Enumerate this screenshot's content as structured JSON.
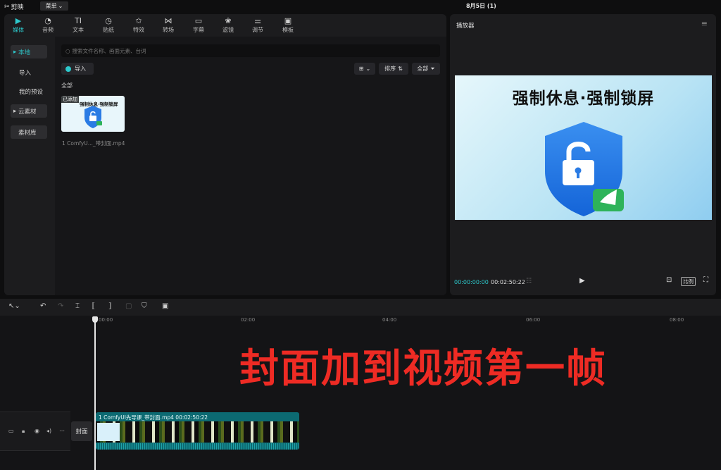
{
  "app": {
    "name": "剪映",
    "menu_label": "菜单",
    "project_title": "8月5日 (1)"
  },
  "tabs": [
    {
      "label": "媒体",
      "icon": "media-icon",
      "active": true
    },
    {
      "label": "音频",
      "icon": "audio-icon"
    },
    {
      "label": "文本",
      "icon": "text-icon",
      "glyph": "TI"
    },
    {
      "label": "贴纸",
      "icon": "sticker-icon"
    },
    {
      "label": "特效",
      "icon": "effects-icon"
    },
    {
      "label": "转场",
      "icon": "transition-icon"
    },
    {
      "label": "字幕",
      "icon": "subtitle-icon"
    },
    {
      "label": "滤镜",
      "icon": "filter-icon"
    },
    {
      "label": "调节",
      "icon": "adjust-icon"
    },
    {
      "label": "模板",
      "icon": "template-icon"
    }
  ],
  "sidebar": {
    "items": [
      {
        "label": "本地"
      },
      {
        "label": "导入"
      },
      {
        "label": "我的预设"
      },
      {
        "label": "云素材"
      },
      {
        "label": "素材库"
      }
    ]
  },
  "media": {
    "search_placeholder": "搜索文件名称、画面元素、台词",
    "import_label": "导入",
    "sort_label": "排序",
    "filter_label": "全部",
    "section_label": "全部",
    "items": [
      {
        "badge": "已添加",
        "thumb_title": "强制休息·强制锁屏",
        "name": "1 ComfyU..._带封面.mp4"
      }
    ]
  },
  "player": {
    "title": "播放器",
    "preview_title": "强制休息·强制锁屏",
    "time_current": "00:00:00:00",
    "time_total": "00:02:50:22",
    "ratio_label": "比例"
  },
  "timeline": {
    "ticks": [
      "00:00",
      "02:00",
      "04:00",
      "06:00",
      "08:00"
    ],
    "overlay_text": "封面加到视频第一帧",
    "cover_label": "封面",
    "clip_label": "1 ComfyUI先导课_带封面.mp4   00:02:50:22"
  },
  "colors": {
    "accent": "#2dc9cc",
    "overlay": "#ee2b24",
    "clip": "#0c6a72"
  }
}
